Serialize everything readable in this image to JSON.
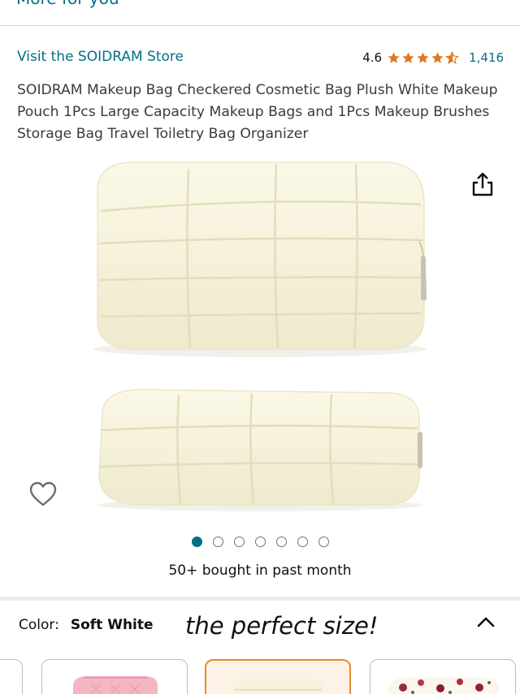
{
  "header": {
    "more_for_you": "More for you"
  },
  "store": {
    "link_text": "Visit the SOIDRAM Store"
  },
  "rating": {
    "value": "4.6",
    "stars": 4.6,
    "count": "1,416"
  },
  "product": {
    "title": "SOIDRAM Makeup Bag Checkered Cosmetic Bag Plush White Makeup Pouch 1Pcs Large Capacity Makeup Bags and 1Pcs Makeup Brushes Storage Bag Travel Toiletry Bag Organizer"
  },
  "gallery": {
    "image_count": 7,
    "active_index": 0
  },
  "social_proof": {
    "bought": "50+ bought in past month"
  },
  "variant": {
    "color_label": "Color:",
    "color_value": "Soft White",
    "overlay_caption": "the perfect size!",
    "swatches": [
      "pink quilted bag",
      "soft white bag",
      "floral bag"
    ]
  },
  "colors": {
    "link": "#007185",
    "star": "#de7921",
    "accent_selected": "#e98b2c"
  }
}
